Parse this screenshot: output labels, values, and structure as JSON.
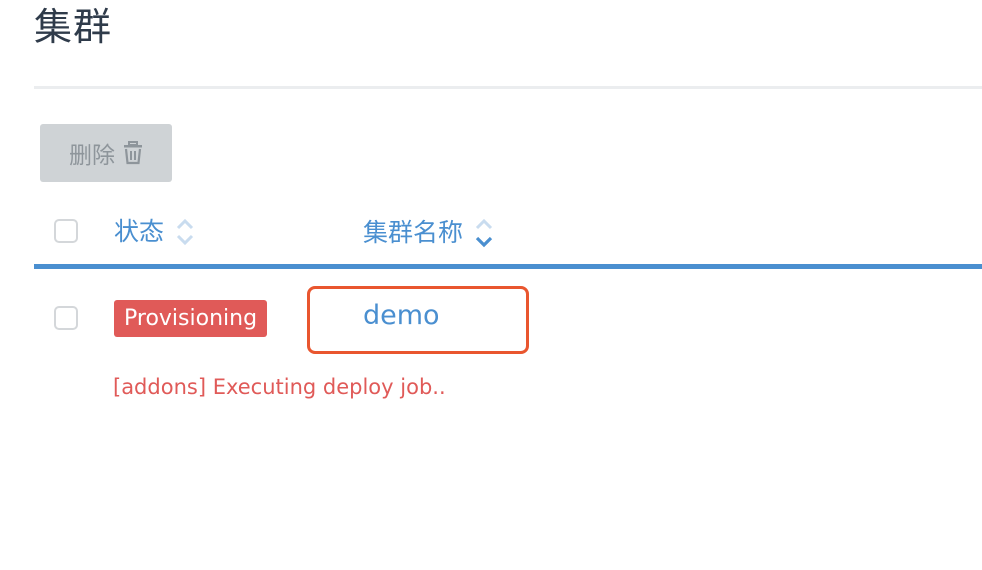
{
  "page": {
    "title": "集群"
  },
  "toolbar": {
    "delete_label": "删除",
    "delete_icon": "trash-icon"
  },
  "table": {
    "columns": [
      {
        "label": "状态",
        "sort_icon": "sort-icon"
      },
      {
        "label": "集群名称",
        "sort_icon": "sort-icon"
      }
    ],
    "rows": [
      {
        "status": "Provisioning",
        "name": "demo",
        "message": "[addons] Executing deploy job.."
      }
    ]
  },
  "colors": {
    "accent": "#4a8fd0",
    "danger": "#e05a58",
    "highlight": "#e9562f",
    "disabled_button": "#cfd3d6"
  }
}
